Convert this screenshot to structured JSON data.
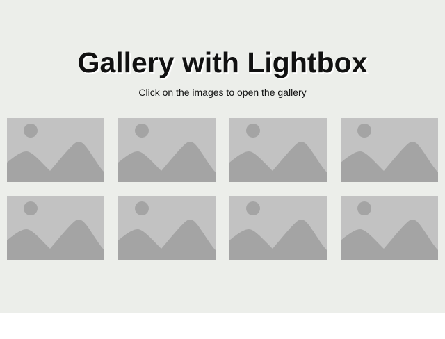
{
  "page": {
    "title": "Gallery with Lightbox",
    "subtitle": "Click on the images to open the gallery"
  },
  "gallery": {
    "thumbnails": [
      {
        "icon": "image-placeholder-icon"
      },
      {
        "icon": "image-placeholder-icon"
      },
      {
        "icon": "image-placeholder-icon"
      },
      {
        "icon": "image-placeholder-icon"
      },
      {
        "icon": "image-placeholder-icon"
      },
      {
        "icon": "image-placeholder-icon"
      },
      {
        "icon": "image-placeholder-icon"
      },
      {
        "icon": "image-placeholder-icon"
      }
    ]
  },
  "colors": {
    "page_background": "#eceeea",
    "placeholder_background": "#c2c2c2",
    "placeholder_shape": "#a4a4a4"
  }
}
